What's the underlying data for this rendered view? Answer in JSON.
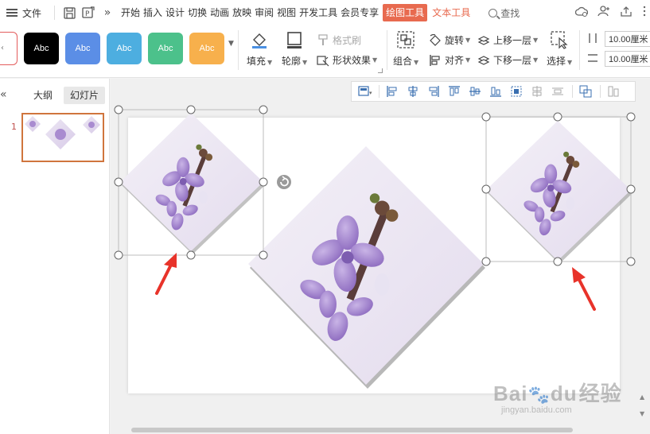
{
  "menu": {
    "file_label": "文件",
    "tabs": [
      "开始",
      "插入",
      "设计",
      "切换",
      "动画",
      "放映",
      "审阅",
      "视图",
      "开发工具",
      "会员专享",
      "绘图工具",
      "文本工具"
    ],
    "search_label": "查找",
    "chevron": "»"
  },
  "ribbon": {
    "styles": [
      {
        "label": "Abc",
        "color": "#000000"
      },
      {
        "label": "Abc",
        "color": "#5b8ee6"
      },
      {
        "label": "Abc",
        "color": "#4daee0"
      },
      {
        "label": "Abc",
        "color": "#4cc18b"
      },
      {
        "label": "Abc",
        "color": "#f7b04c"
      }
    ],
    "fill_label": "填充",
    "outline_label": "轮廓",
    "format_painter_label": "格式刷",
    "shape_effects_label": "形状效果",
    "group_label": "组合",
    "rotate_label": "旋转",
    "align_label": "对齐",
    "bring_forward_label": "上移一层",
    "send_backward_label": "下移一层",
    "select_label": "选择",
    "height_value": "10.00厘米",
    "width_value": "10.00厘米"
  },
  "left_panel": {
    "collapse_glyph": "«",
    "tab_outline": "大纲",
    "tab_slides": "幻灯片",
    "slide_number": "1"
  },
  "watermark": {
    "brand": "Bai",
    "brand_tail": "du",
    "cn": "经验",
    "url": "jingyan.baidu.com"
  },
  "colors": {
    "accent": "#e86a4f",
    "arrow": "#e8332a",
    "selected_thumb_border": "#d0753d"
  }
}
